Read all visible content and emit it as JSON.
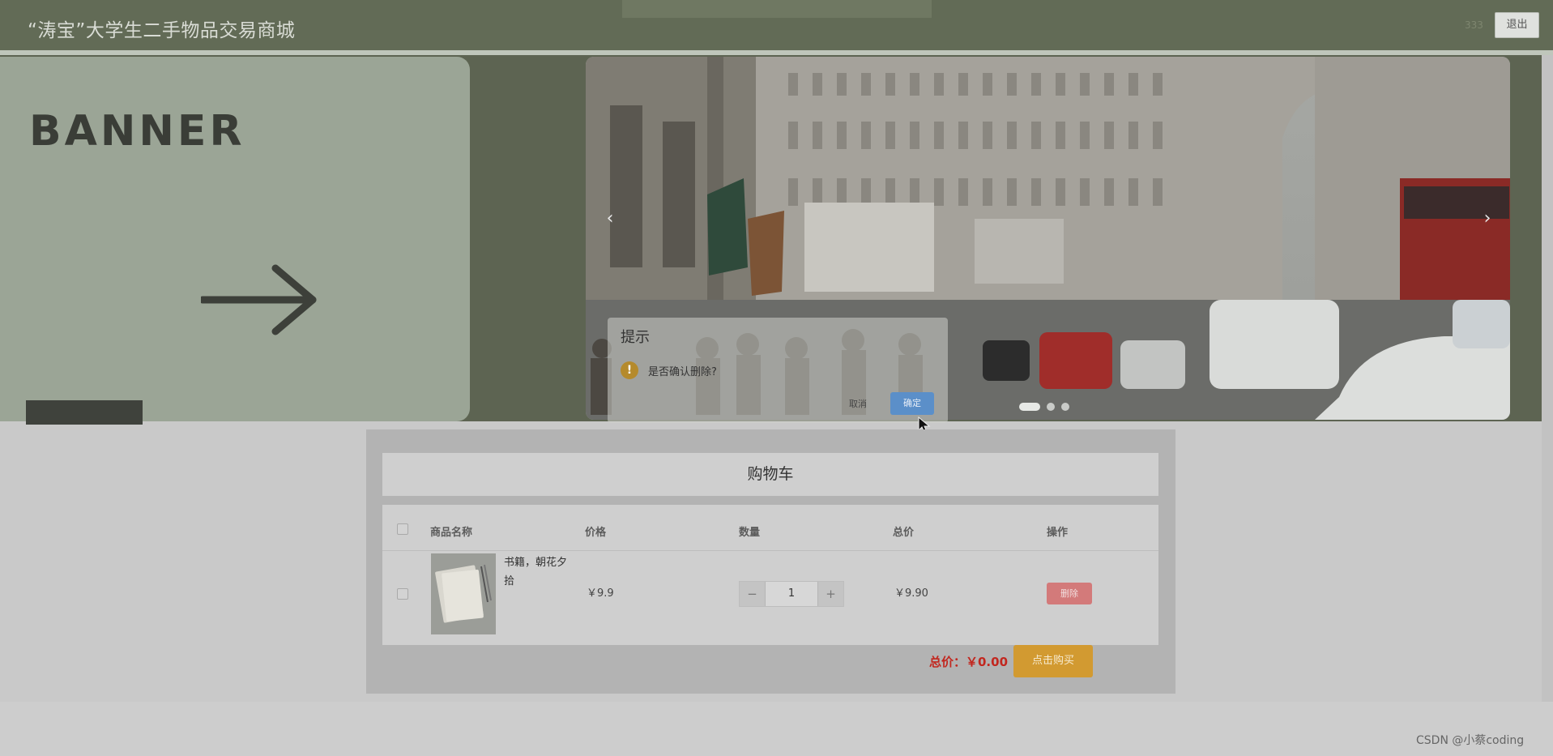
{
  "header": {
    "title": "“涛宝”大学生二手物品交易商城",
    "user": "333",
    "logout_label": "退出"
  },
  "banner": {
    "card_text": "BANNER",
    "prev_arrow": "‹",
    "next_arrow": "›",
    "slide_count": 3,
    "active_slide": 1
  },
  "dialog": {
    "title": "提示",
    "icon": "warning-icon",
    "message": "是否确认删除?",
    "cancel_label": "取消",
    "confirm_label": "确定"
  },
  "cart": {
    "title": "购物车",
    "columns": [
      "商品名称",
      "价格",
      "数量",
      "总价",
      "操作"
    ],
    "items": [
      {
        "name": "书籍，朝花夕拾",
        "price": "￥9.9",
        "quantity": "1",
        "subtotal": "￥9.90",
        "action_label": "删除"
      }
    ],
    "stepper_minus": "−",
    "stepper_plus": "+",
    "total_label": "总价：￥0.00",
    "buy_label": "点击购买"
  },
  "watermark": "CSDN @小蔡coding",
  "colors": {
    "header": "#626b56",
    "delete": "#d37a7a",
    "buy": "#d29a31",
    "total": "#c2271f",
    "confirm": "#5b8fc9"
  }
}
